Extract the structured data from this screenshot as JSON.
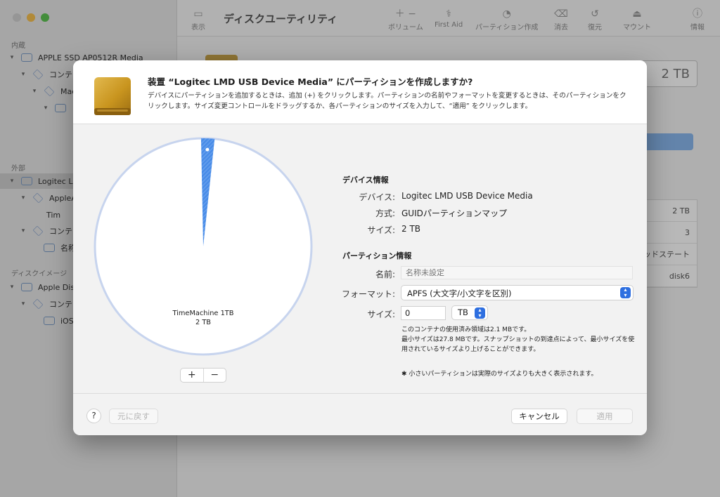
{
  "app": {
    "title": "ディスクユーティリティ",
    "toolbar": [
      {
        "label": "表示",
        "icon": "sidebar-icon"
      },
      {
        "label": "ボリューム",
        "icon": "plus-minus-icon"
      },
      {
        "label": "First Aid",
        "icon": "stethoscope-icon"
      },
      {
        "label": "パーティション作成",
        "icon": "partition-icon"
      },
      {
        "label": "消去",
        "icon": "erase-icon"
      },
      {
        "label": "復元",
        "icon": "restore-icon"
      },
      {
        "label": "マウント",
        "icon": "mount-icon"
      },
      {
        "label": "情報",
        "icon": "info-icon"
      }
    ]
  },
  "sidebar": {
    "sections": [
      "内蔵",
      "外部",
      "ディスクイメージ"
    ],
    "items": [
      {
        "label": "APPLE SSD AP0512R Media"
      },
      {
        "label": "コンテナ"
      },
      {
        "label": "Mac"
      },
      {
        "label": ""
      },
      {
        "label": ""
      },
      {
        "label": ""
      },
      {
        "label": "Logitec L"
      },
      {
        "label": "AppleA"
      },
      {
        "label": "Tim"
      },
      {
        "label": "コンテナ"
      },
      {
        "label": "名称"
      },
      {
        "label": "Apple Dis"
      },
      {
        "label": "コンテナ"
      },
      {
        "label": "iOS"
      }
    ]
  },
  "background_content": {
    "capacity": "2 TB",
    "rows": [
      "2 TB",
      "3",
      "ッドステート",
      "disk6"
    ]
  },
  "dialog": {
    "title": "装置 “Logitec LMD USB Device Media” にパーティションを作成しますか?",
    "description": "デバイスにパーティションを追加するときは、追加 (+) をクリックします。パーティションの名前やフォーマットを変更するときは、そのパーティションをクリックします。サイズ変更コントロールをドラッグするか、各パーティションのサイズを入力して、“適用” をクリックします。",
    "pie": {
      "partition_name": "TimeMachine 1TB",
      "partition_size": "2 TB",
      "new_partition_fraction": 0.02,
      "colors": {
        "main": "#ffffff",
        "border": "#c7d4ee",
        "new_slice": "#4a8de8"
      }
    },
    "pie_add_label": "+",
    "pie_remove_label": "−",
    "device_info": {
      "heading": "デバイス情報",
      "device_label": "デバイス:",
      "device_value": "Logitec LMD USB Device Media",
      "scheme_label": "方式:",
      "scheme_value": "GUIDパーティションマップ",
      "size_label": "サイズ:",
      "size_value": "2 TB"
    },
    "partition_info": {
      "heading": "パーティション情報",
      "name_label": "名前:",
      "name_placeholder": "名称未設定",
      "format_label": "フォーマット:",
      "format_value": "APFS (大文字/小文字を区別)",
      "size_label": "サイズ:",
      "size_value": "0",
      "size_unit": "TB",
      "note1": "このコンテナの使用済み領域は2.1 MBです。",
      "note2": "最小サイズは27.8 MBです。スナップショットの到達点によって、最小サイズを使用されているサイズより上げることができます。",
      "note3": "✱ 小さいパーティションは実際のサイズよりも大きく表示されます。"
    },
    "footer": {
      "help": "?",
      "revert": "元に戻す",
      "cancel": "キャンセル",
      "apply": "適用"
    }
  }
}
